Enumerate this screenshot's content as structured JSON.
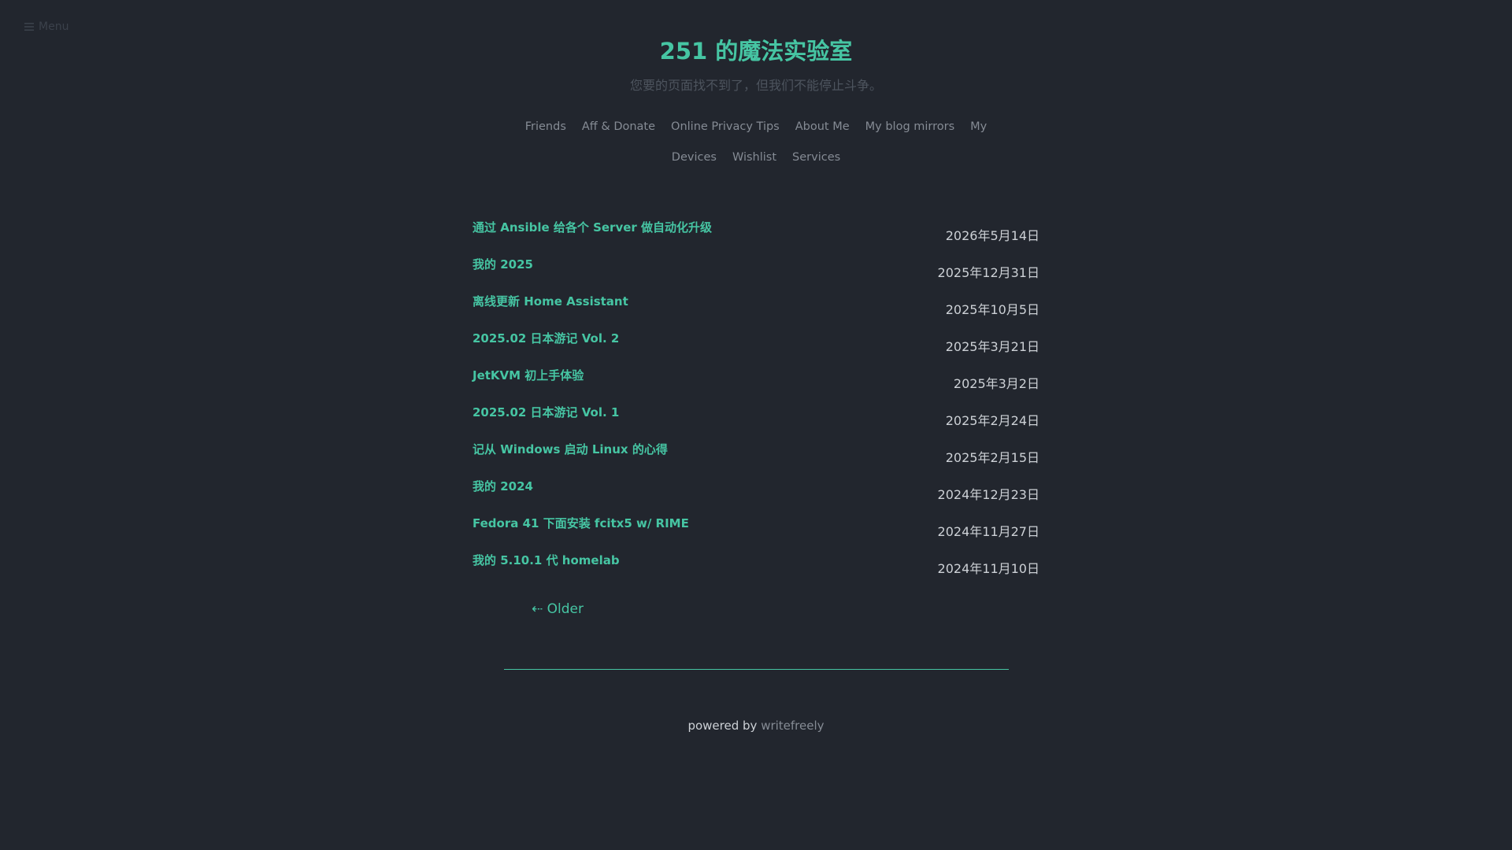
{
  "menu": {
    "label": "Menu",
    "icon": "hamburger-icon"
  },
  "header": {
    "title": "251 的魔法实验室",
    "description": "您要的页面找不到了，但我们不能停止斗争。"
  },
  "nav": {
    "line1": [
      {
        "label": "Friends"
      },
      {
        "label": "Aff & Donate"
      },
      {
        "label": "Online Privacy Tips"
      },
      {
        "label": "About Me"
      },
      {
        "label": "My blog mirrors"
      },
      {
        "label": "My"
      }
    ],
    "line2": [
      {
        "label": "Devices"
      },
      {
        "label": "Wishlist"
      },
      {
        "label": "Services"
      }
    ]
  },
  "posts": [
    {
      "title": "通过 Ansible 给各个 Server 做自动化升级",
      "date": "2026年5月14日"
    },
    {
      "title": "我的 2025",
      "date": "2025年12月31日"
    },
    {
      "title": "离线更新 Home Assistant",
      "date": "2025年10月5日"
    },
    {
      "title": "2025.02 日本游记 Vol. 2",
      "date": "2025年3月21日"
    },
    {
      "title": "JetKVM 初上手体验",
      "date": "2025年3月2日"
    },
    {
      "title": "2025.02 日本游记 Vol. 1",
      "date": "2025年2月24日"
    },
    {
      "title": "记从 Windows 启动 Linux 的心得",
      "date": "2025年2月15日"
    },
    {
      "title": "我的 2024",
      "date": "2024年12月23日"
    },
    {
      "title": "Fedora 41 下面安装 fcitx5 w/ RIME",
      "date": "2024年11月27日"
    },
    {
      "title": "我的 5.10.1 代 homelab",
      "date": "2024年11月10日"
    }
  ],
  "pagination": {
    "older_label": "⇠ Older"
  },
  "footer": {
    "powered_by": "powered by",
    "engine": "writefreely"
  },
  "colors": {
    "background": "#22262e",
    "accent": "#46c5a3",
    "nav_text": "#858b94",
    "date_text": "#cdd1d6"
  }
}
